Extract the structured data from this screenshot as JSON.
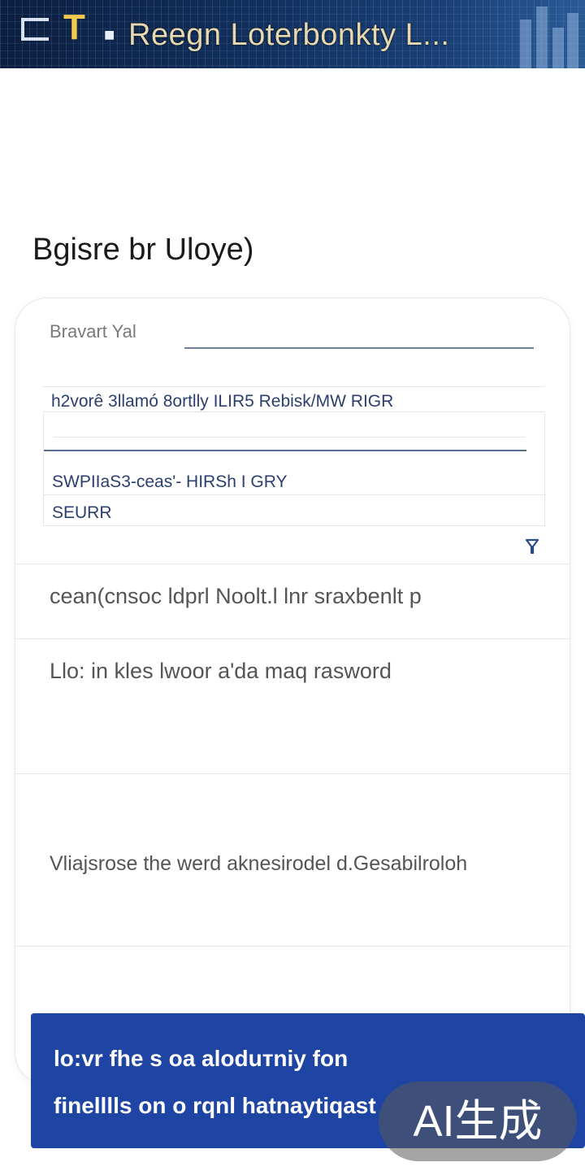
{
  "banner": {
    "title": "Reegn Loterbonkty L..."
  },
  "page": {
    "heading": "Bgisre br Uloye)"
  },
  "form": {
    "field_label": "Bravart Yal",
    "field_value": "",
    "dropdown": {
      "selected": "h2vorê 3llamó 8ortlly ILIR5 Rebisk/MW RIGR",
      "search_placeholder": "",
      "options": [
        "SWPIIaS3-ceas'- HIRSh I GRY",
        "SEURR"
      ]
    },
    "filter_icon": "filter-icon"
  },
  "sections": [
    {
      "text": "cean(cnsoc ldprl Noolt.l lnr sraxbenlt p"
    },
    {
      "text": "Llo: in kles lwoor a'da maq rasword"
    },
    {
      "text": "Vliajsrose the werd aknesirodel d.Gesabilroloh"
    }
  ],
  "cta": {
    "line1": "lo:vr  fhe s oa aloduтniy fon",
    "line2": "finelllls  on o rqnl hatnaytiqast"
  },
  "watermark": {
    "text": "AI生成"
  },
  "colors": {
    "accent": "#1e45a3",
    "banner_dark": "#0c1e3e",
    "link_text": "#2b3f6e"
  }
}
